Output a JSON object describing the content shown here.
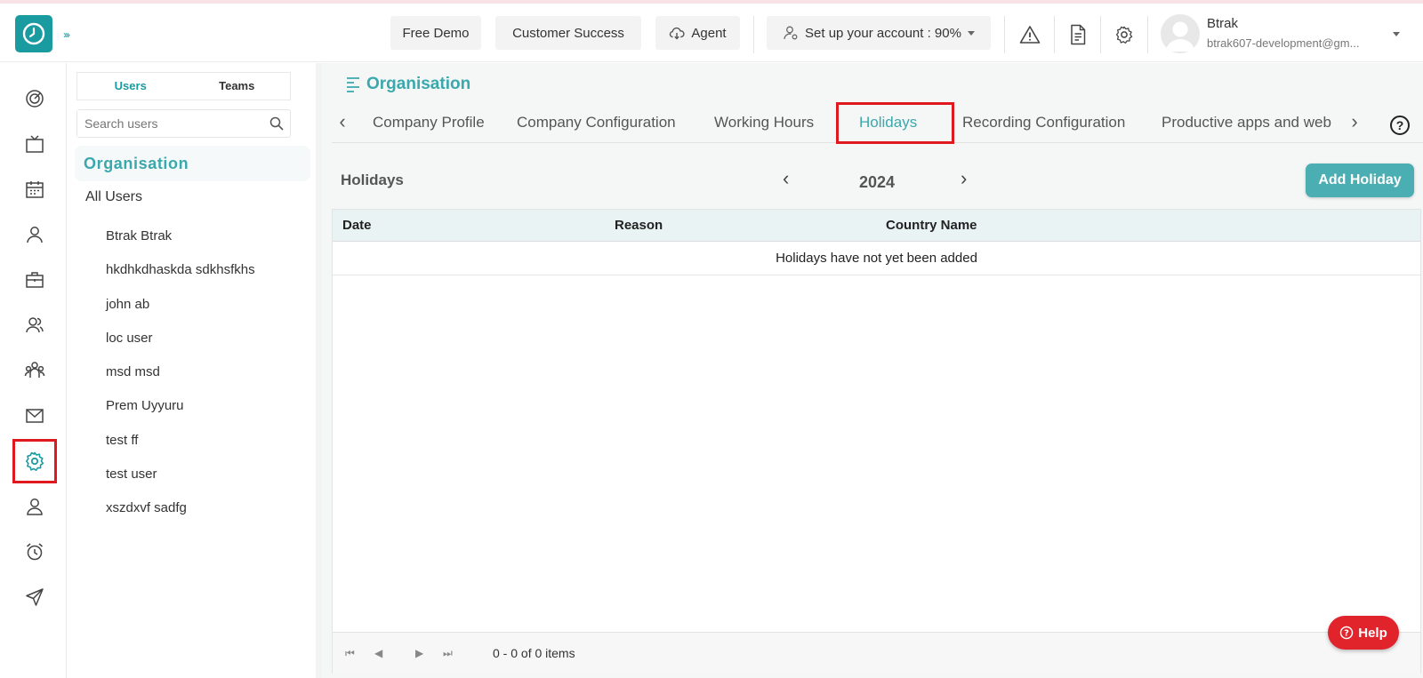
{
  "header": {
    "free_demo": "Free Demo",
    "customer_success": "Customer Success",
    "agent": "Agent",
    "setup": "Set up your account : 90%",
    "user_name": "Btrak",
    "user_email": "btrak607-development@gm..."
  },
  "users_panel": {
    "tabs": [
      "Users",
      "Teams"
    ],
    "search_placeholder": "Search users",
    "org_title": "Organisation",
    "all_users": "All Users",
    "users": [
      "Btrak Btrak",
      "hkdhkdhaskda sdkhsfkhs",
      "john ab",
      "loc user",
      "msd msd",
      "Prem Uyyuru",
      "test ff",
      "test user",
      "xszdxvf sadfg"
    ]
  },
  "main": {
    "title": "Organisation",
    "tabs": [
      "Company Profile",
      "Company Configuration",
      "Working Hours",
      "Holidays",
      "Recording Configuration",
      "Productive apps and web"
    ],
    "active_tab": "Holidays",
    "section_title": "Holidays",
    "year": "2024",
    "add_button": "Add Holiday",
    "columns": [
      "Date",
      "Reason",
      "Country Name"
    ],
    "empty_message": "Holidays have not yet been added",
    "pager_info": "0 - 0 of 0 items",
    "help_button": "Help"
  },
  "colors": {
    "accent": "#3aa8ac",
    "highlight": "#e0191e",
    "help": "#e1232c"
  }
}
